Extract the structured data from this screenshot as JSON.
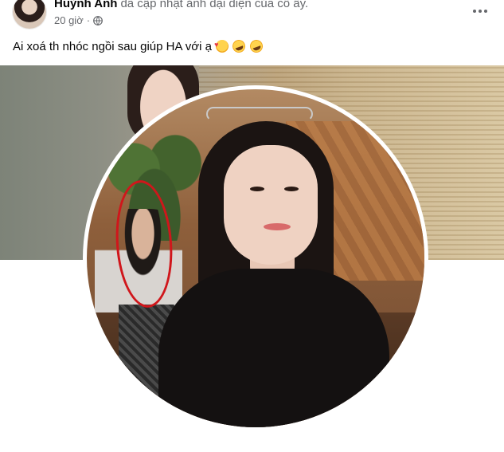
{
  "post": {
    "author": "Huỳnh Anh",
    "action": "đã cập nhật ảnh đại diện của cô ấy.",
    "time": "20 giờ",
    "separator": "·",
    "audience_icon": "globe-icon",
    "more_icon": "more-options-icon",
    "caption": "Ai xoá th nhóc ngồi sau giúp HA với ạ",
    "caption_emojis": [
      "smiling-face-with-hearts",
      "rolling-on-floor-laughing",
      "rolling-on-floor-laughing"
    ]
  },
  "colors": {
    "text_primary": "#050505",
    "text_secondary": "#65676b",
    "annotation_red": "#d0161b"
  }
}
